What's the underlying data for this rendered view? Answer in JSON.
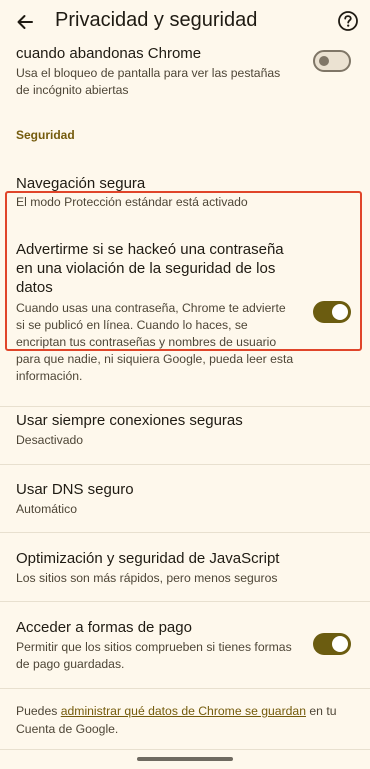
{
  "header": {
    "title": "Privacidad y seguridad"
  },
  "items": {
    "lock_incognito": {
      "title": "cuando abandonas Chrome",
      "subtitle": "Usa el bloqueo de pantalla para ver las pestañas de incógnito abiertas",
      "toggle": "off"
    },
    "section_security": "Seguridad",
    "safe_browsing": {
      "title": "Navegación segura",
      "subtitle": "El modo Protección estándar está activado"
    },
    "password_leak": {
      "title_line1": "Advertirme si se hackeó una contraseña",
      "title_line2": "en una violación de la seguridad de los",
      "title_line3": "datos",
      "subtitle": "Cuando usas una contraseña, Chrome te advierte si se publicó en línea. Cuando lo haces, se encriptan tus contraseñas y nombres de usuario para que nadie, ni siquiera Google, pueda leer esta información.",
      "toggle": "on"
    },
    "https_only": {
      "title": "Usar siempre conexiones seguras",
      "subtitle": "Desactivado"
    },
    "secure_dns": {
      "title": "Usar DNS seguro",
      "subtitle": "Automático"
    },
    "javascript": {
      "title": "Optimización y seguridad de JavaScript",
      "subtitle": "Los sitios son más rápidos, pero menos seguros"
    },
    "payment_methods": {
      "title": "Acceder a formas de pago",
      "subtitle": "Permitir que los sitios comprueben si tienes formas de pago guardadas.",
      "toggle": "on"
    }
  },
  "footer": {
    "prefix": "Puedes ",
    "link": "administrar qué datos de Chrome se guardan",
    "suffix": " en tu Cuenta de Google."
  },
  "icons": {
    "back": "arrow-left-icon",
    "help": "help-circle-icon"
  },
  "colors": {
    "background": "#fef8ec",
    "accent": "#6b5c10",
    "highlight": "#e0452a",
    "link": "#745b0c"
  }
}
